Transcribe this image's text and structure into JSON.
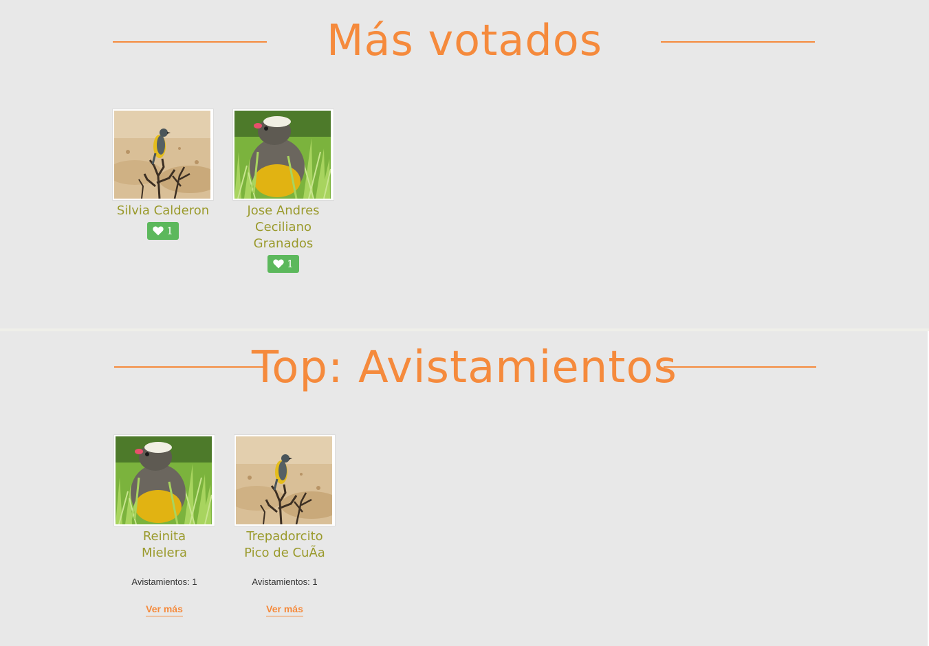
{
  "most_voted": {
    "title": "Más votados",
    "items": [
      {
        "name": "Silvia Calderon",
        "likes": "1",
        "photo": "perched-bird-on-twig-icon"
      },
      {
        "name": "Jose Andres Ceciliano Granados",
        "likes": "1",
        "photo": "grey-yellow-bird-in-grass-icon"
      }
    ]
  },
  "top_sightings": {
    "title": "Top: Avistamientos",
    "items": [
      {
        "name": "Reinita Mielera",
        "count_text": "Avistamientos: 1",
        "link": "Ver más",
        "photo": "grey-yellow-bird-in-grass-icon"
      },
      {
        "name": "Trepadorcito Pico de CuÃa",
        "count_text": "Avistamientos: 1",
        "link": "Ver más",
        "photo": "perched-bird-on-twig-icon"
      }
    ]
  },
  "colors": {
    "accent": "#f58a3c",
    "name_text": "#9a9a2c",
    "like_badge": "#5cb85c",
    "background": "#e8e8e8"
  },
  "icons": {
    "like": "heart-icon"
  }
}
